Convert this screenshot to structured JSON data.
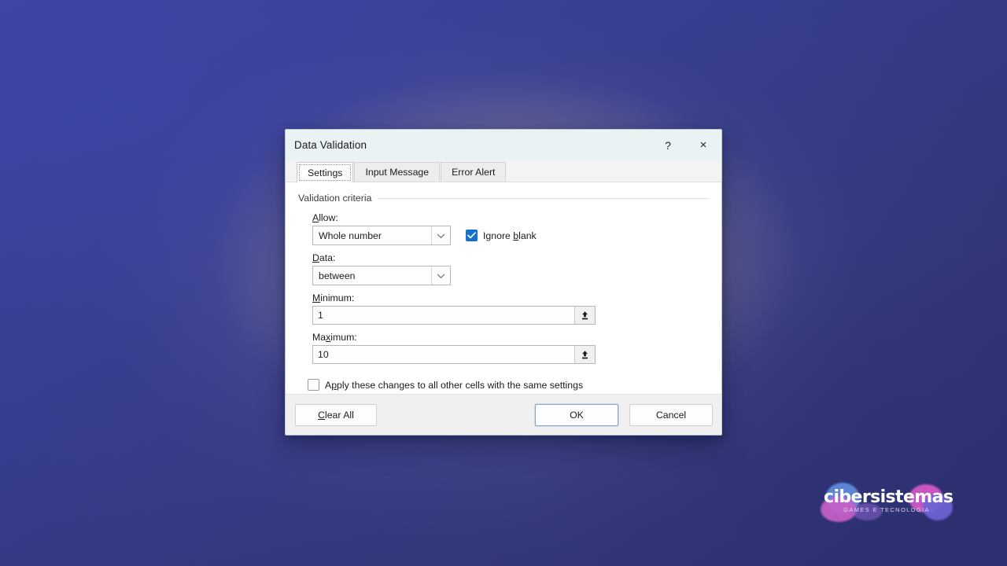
{
  "desktop": {
    "background_colors": {
      "top_left": "#3e45a2",
      "top_right": "#313578",
      "bottom_left": "#2f3374",
      "center_glow": "#d6c48c"
    }
  },
  "dialog": {
    "title": "Data Validation",
    "titlebar": {
      "help_icon": "question-mark-icon",
      "help_label": "?",
      "close_icon": "close-icon",
      "close_label": "×"
    },
    "tabs": [
      {
        "label": "Settings",
        "active": true
      },
      {
        "label": "Input Message",
        "active": false
      },
      {
        "label": "Error Alert",
        "active": false
      }
    ],
    "group": {
      "label": "Validation criteria"
    },
    "fields": {
      "allow": {
        "label": "Allow:",
        "label_mnemonic": "A",
        "value": "Whole number",
        "dropdown_icon": "chevron-down-icon"
      },
      "ignore_blank": {
        "label_pre": "I",
        "label_mid": "gnore ",
        "label_mnemonic": "b",
        "label_post": "lank",
        "full_label": "Ignore blank",
        "checked": true,
        "check_icon": "checkmark-icon",
        "accent_color": "#1372cf"
      },
      "data": {
        "label": "Data:",
        "label_mnemonic": "D",
        "value": "between",
        "dropdown_icon": "chevron-down-icon"
      },
      "minimum": {
        "label": "Minimum:",
        "label_mnemonic": "M",
        "value": "1",
        "range_icon": "collapse-dialog-icon"
      },
      "maximum": {
        "label": "Maximum:",
        "label_mnemonic": "x",
        "value": "10",
        "range_icon": "collapse-dialog-icon"
      },
      "apply_all": {
        "label": "Apply these changes to all other cells with the same settings",
        "label_mnemonic": "p",
        "checked": false
      }
    },
    "footer": {
      "clear_all": "Clear All",
      "clear_all_mnemonic": "C",
      "ok": "OK",
      "cancel": "Cancel"
    }
  },
  "watermark_logo": {
    "word": "cibersistemas",
    "tagline": "GAMES E TECNOLOGIA",
    "colors": {
      "blue": "#5b86d6",
      "magenta": "#c95fc8",
      "violet": "#6d63d4"
    }
  }
}
